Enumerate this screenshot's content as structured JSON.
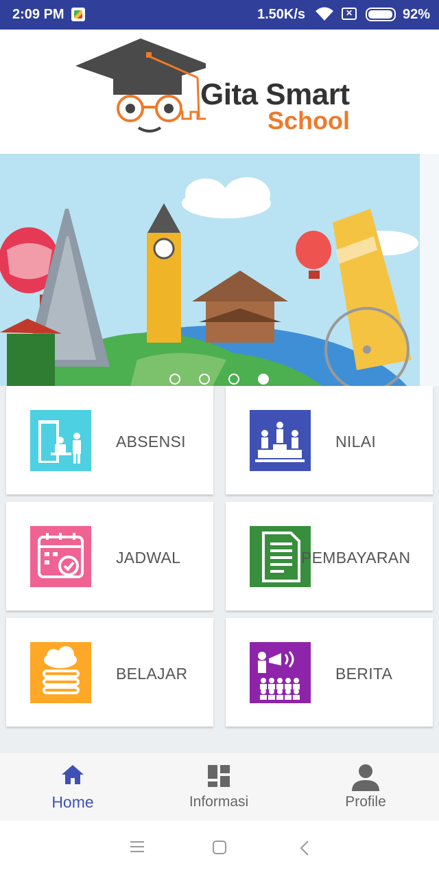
{
  "status_bar": {
    "time": "2:09 PM",
    "net_speed": "1.50K/s",
    "battery": "92%",
    "sim_glyph": "✕",
    "icons": [
      "maps-notification-icon",
      "wifi-icon",
      "no-sim-icon",
      "battery-icon"
    ]
  },
  "header": {
    "logo_line1": "Gita Smart",
    "logo_line2": "School",
    "colors": {
      "dark": "#333333",
      "orange": "#ee7a2b"
    }
  },
  "banner": {
    "slide_count": 4,
    "active_slide_index": 3,
    "sky_color": "#b9e3f2"
  },
  "menu": [
    {
      "label": "ABSENSI",
      "icon": "attendance-door-icon",
      "color": "#4dd0e1"
    },
    {
      "label": "NILAI",
      "icon": "podium-ranking-icon",
      "color": "#3f51b5"
    },
    {
      "label": "JADWAL",
      "icon": "calendar-check-icon",
      "color": "#f06292"
    },
    {
      "label": "PEMBAYARAN",
      "icon": "payment-document-icon",
      "color": "#388e3c"
    },
    {
      "label": "BELAJAR",
      "icon": "books-cloud-icon",
      "color": "#ffa726"
    },
    {
      "label": "BERITA",
      "icon": "announcement-megaphone-icon",
      "color": "#8e24aa"
    }
  ],
  "bottom_nav": {
    "active": "home",
    "items": [
      {
        "label": "Home",
        "icon": "home-icon"
      },
      {
        "label": "Informasi",
        "icon": "dashboard-grid-icon"
      },
      {
        "label": "Profile",
        "icon": "person-icon"
      }
    ],
    "active_color": "#3f51b5"
  },
  "system_nav": {
    "icons": [
      "menu-icon",
      "home-square-icon",
      "back-icon"
    ]
  }
}
